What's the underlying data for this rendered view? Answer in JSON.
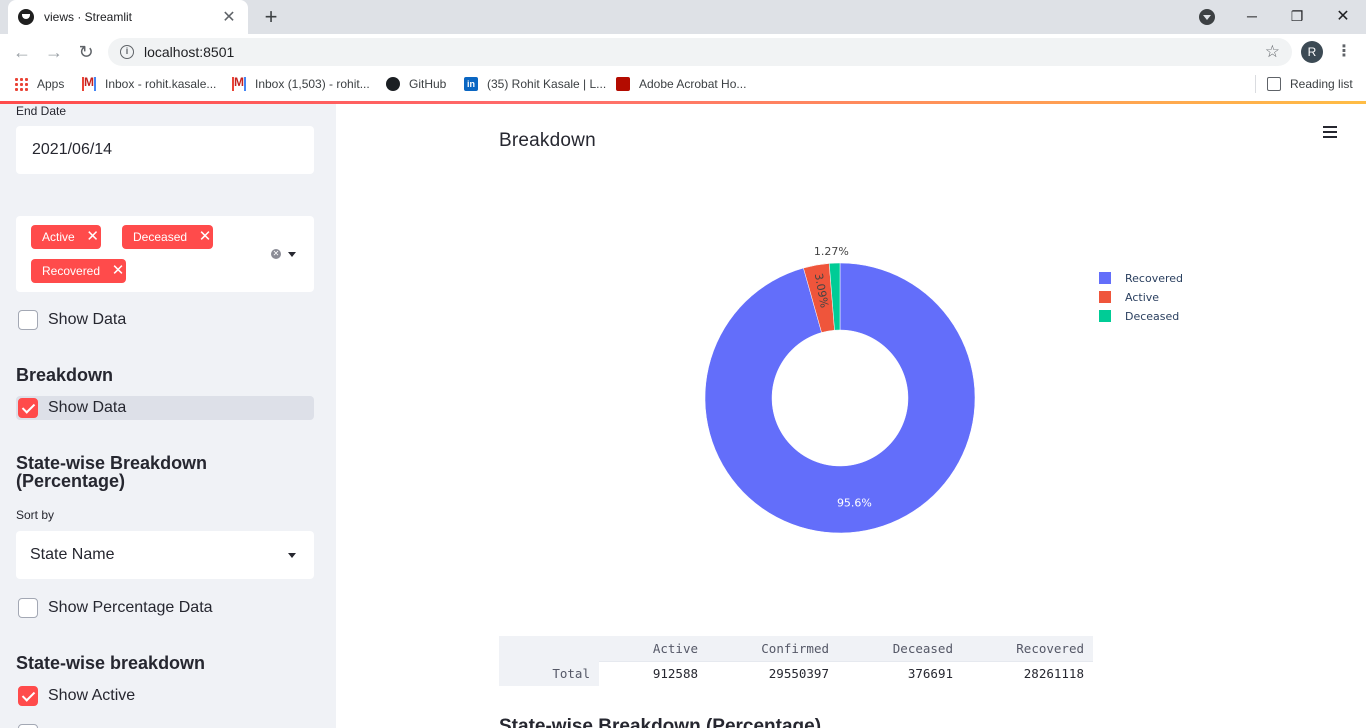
{
  "browser": {
    "tab_title": "views · Streamlit",
    "url": "localhost:8501",
    "profile_initial": "R",
    "bookmarks": [
      "Apps",
      "Inbox - rohit.kasale...",
      "Inbox (1,503) - rohit...",
      "GitHub",
      "(35) Rohit Kasale | L...",
      "Adobe Acrobat Ho..."
    ],
    "reading_list": "Reading list"
  },
  "sidebar": {
    "end_date_label": "End Date",
    "end_date_value": "2021/06/14",
    "chips": [
      "Active",
      "Deceased",
      "Recovered"
    ],
    "show_data_1": "Show Data",
    "breakdown_heading": "Breakdown",
    "show_data_2": "Show Data",
    "statewise_pct_heading_line1": "State-wise Breakdown",
    "statewise_pct_heading_line2": "(Percentage)",
    "sort_by_label": "Sort by",
    "sort_by_value": "State Name",
    "show_pct_data": "Show Percentage Data",
    "statewise_heading": "State-wise breakdown",
    "show_active": "Show Active"
  },
  "main": {
    "heading": "Breakdown",
    "next_heading": "State-wise Breakdown (Percentage)"
  },
  "chart_data": {
    "type": "pie",
    "hole": true,
    "labels": [
      "Recovered",
      "Active",
      "Deceased"
    ],
    "values": [
      28261118,
      912588,
      376691
    ],
    "percent_labels": [
      "95.6%",
      "3.09%",
      "1.27%"
    ],
    "colors": [
      "#636efa",
      "#ef553b",
      "#00cc96"
    ],
    "legend_position": "right"
  },
  "table": {
    "columns": [
      "Active",
      "Confirmed",
      "Deceased",
      "Recovered"
    ],
    "rows": [
      {
        "index": "Total",
        "values": [
          "912588",
          "29550397",
          "376691",
          "28261118"
        ]
      }
    ]
  }
}
